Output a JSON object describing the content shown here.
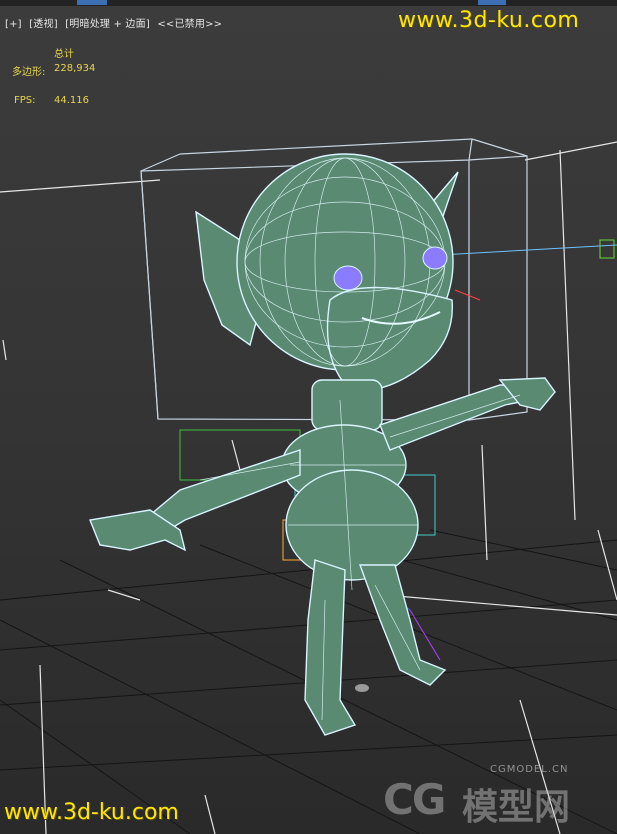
{
  "viewport": {
    "label_items": [
      "[+]",
      "[透视]",
      "[明暗处理 + 边面]",
      "<<已禁用>>"
    ],
    "stats": {
      "total_label": "总计",
      "polygons_label": "多边形:",
      "polygons_value": "228,934",
      "fps_label": "FPS:",
      "fps_value": "44.116"
    }
  },
  "watermarks": {
    "top": "www.3d-ku.com",
    "bottom": "www.3d-ku.com",
    "cg_small": "CGMODEL.CN",
    "cg_mark": "CG",
    "cg_text": "模型网"
  },
  "colors": {
    "mesh_fill": "#5a8a72",
    "wire": "#d8f5ff",
    "bbox": "#c8d4e0",
    "watermark": "#ffe800",
    "stat_text": "#e8d44d",
    "eye": "#8a7bff"
  }
}
